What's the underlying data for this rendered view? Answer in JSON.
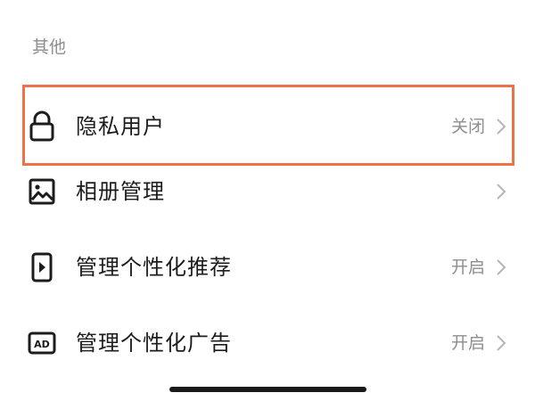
{
  "section": {
    "title": "其他"
  },
  "rows": [
    {
      "label": "隐私用户",
      "value": "关闭",
      "icon": "lock-icon"
    },
    {
      "label": "相册管理",
      "value": "",
      "icon": "image-icon"
    },
    {
      "label": "管理个性化推荐",
      "value": "开启",
      "icon": "phone-play-icon"
    },
    {
      "label": "管理个性化广告",
      "value": "开启",
      "icon": "ad-icon"
    }
  ],
  "colors": {
    "highlight_border": "#ee7248",
    "secondary_text": "#8e8e8e",
    "primary_text": "#1c1c1c"
  }
}
